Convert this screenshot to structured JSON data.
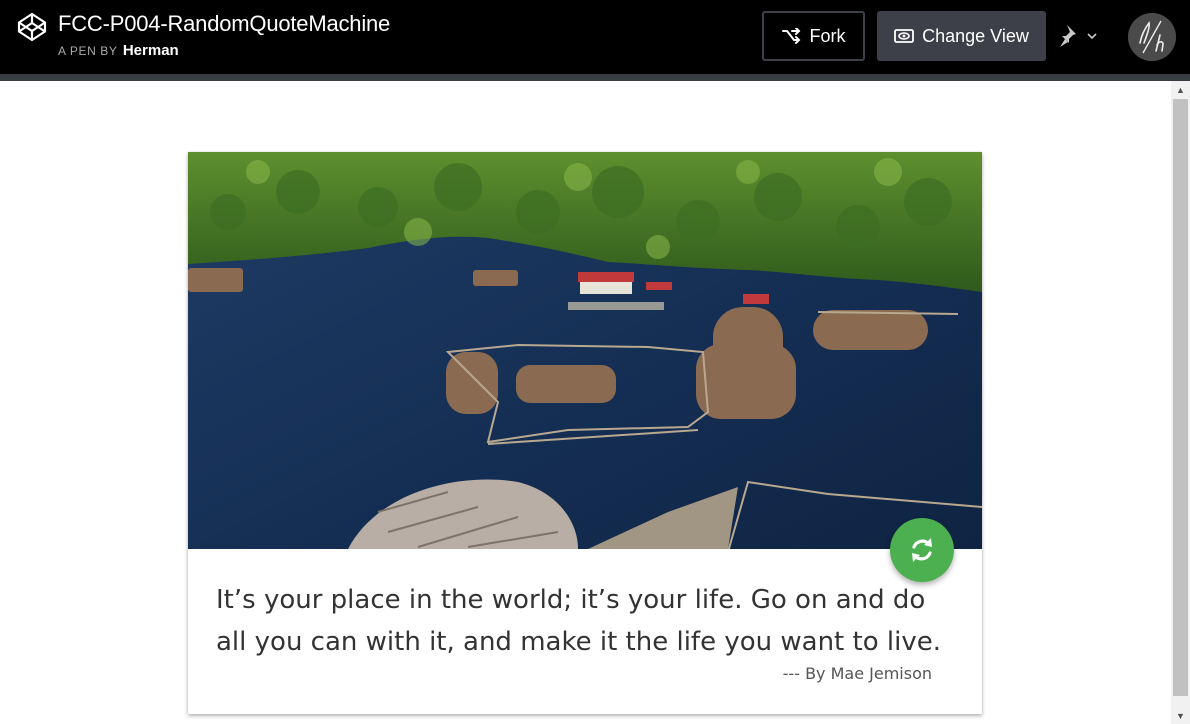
{
  "header": {
    "title": "FCC-P004-RandomQuoteMachine",
    "byline_prefix": "A PEN BY",
    "author": "Herman",
    "fork_label": "Fork",
    "change_view_label": "Change View"
  },
  "quote": {
    "text": "It’s your place in the world; it’s your life. Go on and do all you can with it, and make it the life you want to live.",
    "author": "--- By Mae Jemison"
  },
  "colors": {
    "header_bg": "#000000",
    "button_bg": "#3e4049",
    "refresh_button": "#4caf50"
  },
  "icons": {
    "logo": "codepen-logo-icon",
    "fork": "fork-icon",
    "change_view": "eye-icon",
    "pin": "pin-icon",
    "refresh": "refresh-icon"
  }
}
